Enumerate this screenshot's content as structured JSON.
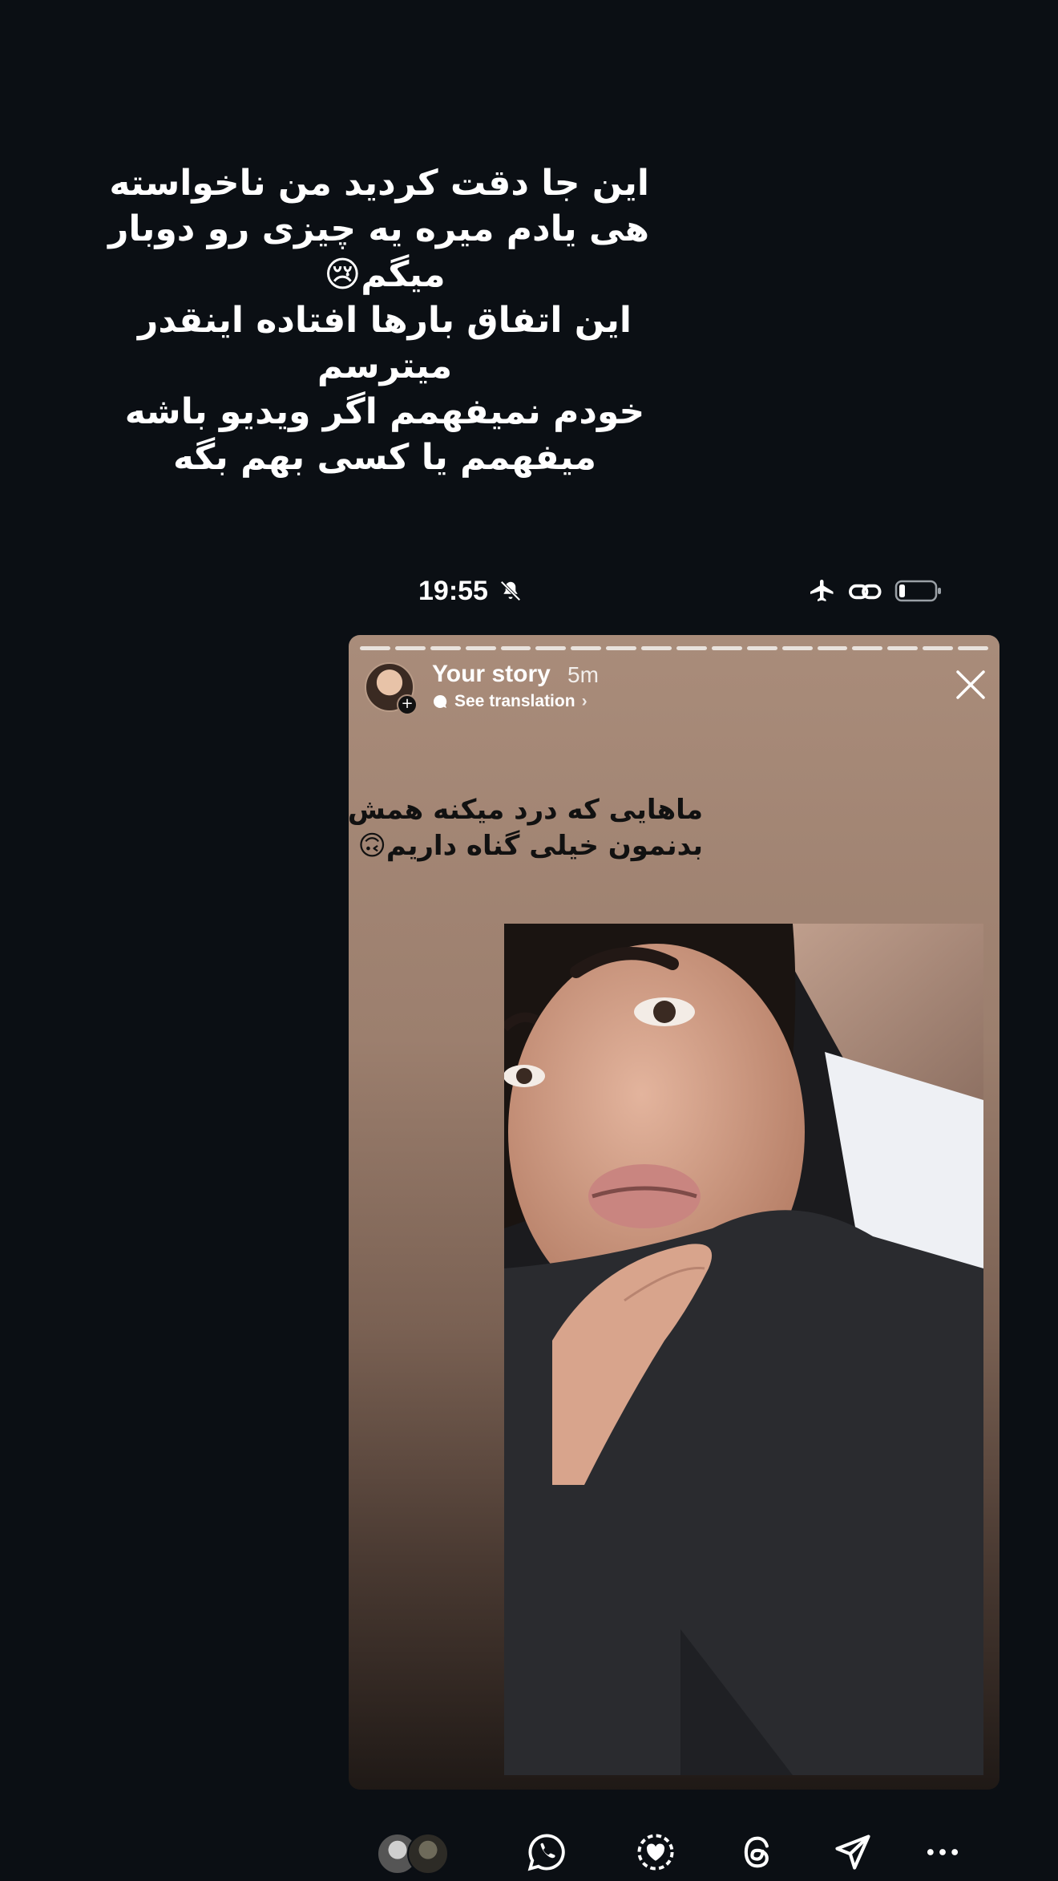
{
  "caption": {
    "lines": [
      "این جا دقت کردید من ناخواسته",
      "هی یادم میره یه چیزی رو دوبار",
      "میگم😢",
      "این اتفاق بارها افتاده اینقدر",
      "میترسم",
      "خودم نمیفهمم اگر ویدیو باشه",
      "میفهمم یا کسی بهم بگه"
    ]
  },
  "status_bar": {
    "time": "19:55",
    "icons": [
      "bell-slash-icon",
      "airplane-icon",
      "link-icon",
      "battery-icon"
    ]
  },
  "story": {
    "segments": 18,
    "owner": "Your story",
    "age": "5m",
    "translation_label": "See translation",
    "text_lines": [
      "ماهایی که درد میکنه همش",
      "بدنمون خیلی گناه داریم🙃"
    ]
  },
  "bottom_bar": {
    "actions": [
      "viewers-avatars",
      "whatsapp-icon",
      "highlight-heart-icon",
      "threads-icon",
      "send-icon",
      "more-icon"
    ]
  },
  "colors": {
    "page_bg": "#0b0f14",
    "story_top": "#a98c7a",
    "story_bottom": "#1f1916"
  }
}
